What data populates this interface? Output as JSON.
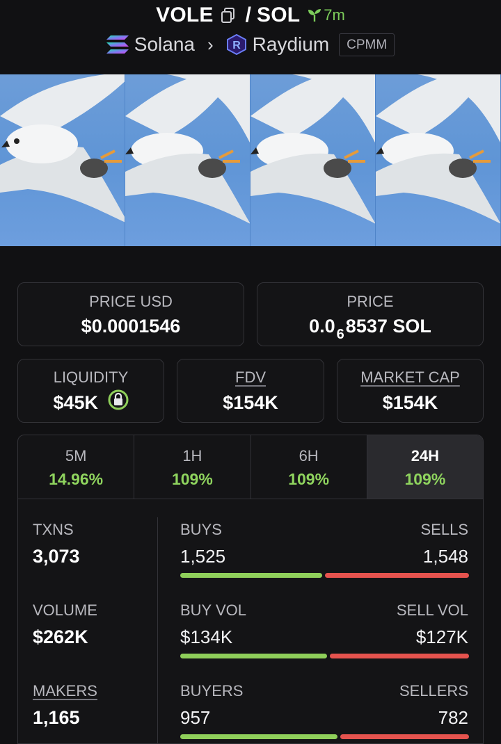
{
  "header": {
    "base_symbol": "VOLE",
    "separator": "/",
    "quote_symbol": "SOL",
    "age": "7m",
    "chain": "Solana",
    "dex": "Raydium",
    "pool_type": "CPMM",
    "icons": [
      "copy-icon",
      "seedling-icon",
      "solana-logo",
      "chevron-right-icon",
      "raydium-logo"
    ]
  },
  "banner": {
    "tiles": 4
  },
  "stats": {
    "price_usd": {
      "label": "PRICE USD",
      "value": "$0.0001546"
    },
    "price": {
      "label": "PRICE",
      "value_prefix": "0.0",
      "value_sub": "6",
      "value_suffix": "8537 SOL"
    },
    "liquidity": {
      "label": "LIQUIDITY",
      "value": "$45K"
    },
    "fdv": {
      "label": "FDV",
      "value": "$154K"
    },
    "market_cap": {
      "label": "MARKET CAP",
      "value": "$154K"
    }
  },
  "timeframes": [
    {
      "label": "5M",
      "change": "14.96%"
    },
    {
      "label": "1H",
      "change": "109%"
    },
    {
      "label": "6H",
      "change": "109%"
    },
    {
      "label": "24H",
      "change": "109%"
    }
  ],
  "active_timeframe": "24H",
  "metrics": {
    "txns": {
      "label": "TXNS",
      "value": "3,073"
    },
    "volume": {
      "label": "VOLUME",
      "value": "$262K"
    },
    "makers": {
      "label": "MAKERS",
      "value": "1,165"
    },
    "buys": {
      "label": "BUYS",
      "value": "1,525"
    },
    "sells": {
      "label": "SELLS",
      "value": "1,548"
    },
    "buy_vol": {
      "label": "BUY VOL",
      "value": "$134K"
    },
    "sell_vol": {
      "label": "SELL VOL",
      "value": "$127K"
    },
    "buyers": {
      "label": "BUYERS",
      "value": "957"
    },
    "sellers": {
      "label": "SELLERS",
      "value": "782"
    },
    "ratios": {
      "txns_buy_share": 0.496,
      "vol_buy_share": 0.513,
      "makers_buy_share": 0.55
    }
  },
  "colors": {
    "positive": "#8fd45e",
    "buy_bar": "#8fcf5a",
    "sell_bar": "#e5534e",
    "age": "#7ccc5a"
  }
}
